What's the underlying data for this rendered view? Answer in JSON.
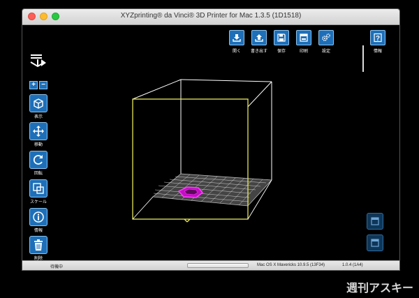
{
  "window": {
    "title": "XYZprinting® da Vinci® 3D Printer for Mac 1.3.5 (1D1518)"
  },
  "toolbar": {
    "open_label": "開く",
    "export_label": "書き出す",
    "save_label": "保存",
    "print_label": "印刷",
    "settings_label": "設定",
    "info_label": "情報"
  },
  "sidebar": {
    "zoom_in": "+",
    "zoom_out": "−",
    "items": [
      {
        "label": "表示"
      },
      {
        "label": "移動"
      },
      {
        "label": "回転"
      },
      {
        "label": "スケール"
      },
      {
        "label": "情報"
      },
      {
        "label": "削除"
      }
    ]
  },
  "status": {
    "state": "待機中",
    "os": "Mac OS X Mavericks 10.9.5 (13F34)",
    "firmware": "1.0.4 (1A4)"
  },
  "watermark": "週刊アスキー",
  "colors": {
    "accent": "#1e6fb8",
    "bed_outline": "#e8e85a",
    "model": "#e020e0"
  }
}
